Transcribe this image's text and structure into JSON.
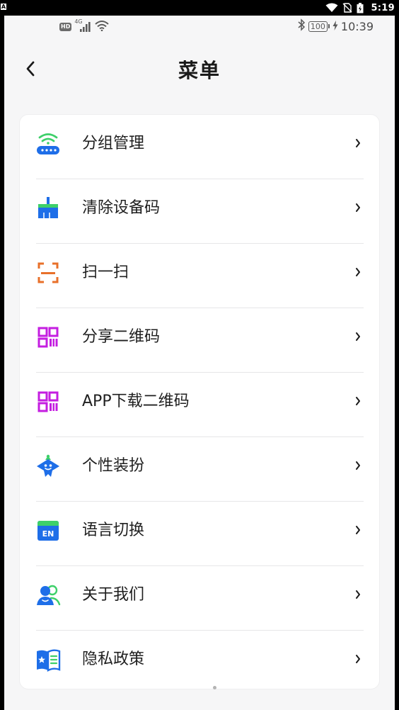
{
  "os_status": {
    "left_badge": "A",
    "time": "5:19",
    "icons": [
      "wifi-icon",
      "no-sim-icon",
      "battery-charging-icon"
    ]
  },
  "inner_status": {
    "hd": "HD",
    "network": "4G",
    "battery": "100",
    "time": "10:39",
    "icons": [
      "signal-icon",
      "wifi-icon",
      "bluetooth-icon",
      "charging-bolt-icon"
    ]
  },
  "nav": {
    "title": "菜单",
    "back_icon": "chevron-left-icon"
  },
  "menu": {
    "items": [
      {
        "label": "分组管理",
        "icon": "router-wifi-icon",
        "color": "#1e6ee8"
      },
      {
        "label": "清除设备码",
        "icon": "broom-icon",
        "color": "#1e6ee8"
      },
      {
        "label": "扫一扫",
        "icon": "scan-frame-icon",
        "color": "#e8702a"
      },
      {
        "label": "分享二维码",
        "icon": "qr-code-icon",
        "color": "#c41ee0"
      },
      {
        "label": "APP下载二维码",
        "icon": "qr-code-icon",
        "color": "#c41ee0"
      },
      {
        "label": "个性装扮",
        "icon": "mascot-star-icon",
        "color": "#1e6ee8"
      },
      {
        "label": "语言切换",
        "icon": "language-en-icon",
        "color": "#1e6ee8"
      },
      {
        "label": "关于我们",
        "icon": "users-icon",
        "color": "#1e6ee8"
      },
      {
        "label": "隐私政策",
        "icon": "privacy-book-icon",
        "color": "#1e6ee8"
      }
    ],
    "chevron_icon": "chevron-right-icon"
  },
  "colors": {
    "background": "#f6f6f7",
    "card": "#ffffff",
    "text": "#1f1f1f",
    "primary_blue": "#1e6ee8",
    "accent_green": "#3ed06a",
    "accent_orange": "#e8702a",
    "accent_magenta": "#c41ee0"
  }
}
